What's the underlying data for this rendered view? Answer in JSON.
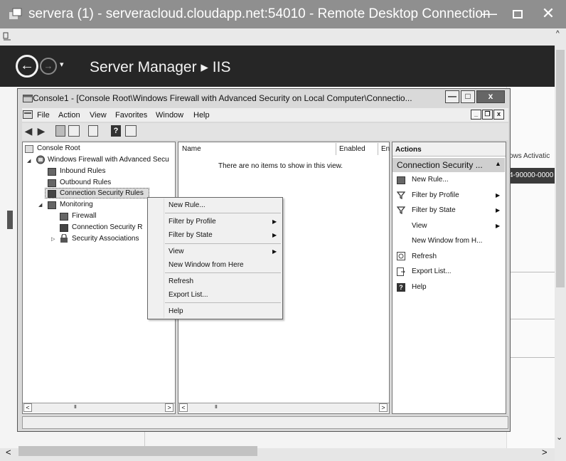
{
  "rdp": {
    "title": "servera (1) - serveracloud.cloudapp.net:54010 - Remote Desktop Connection",
    "minimize_glyph": "—",
    "close_glyph": "✕"
  },
  "server_manager": {
    "breadcrumb": "Server Manager ▸ IIS",
    "back_glyph": "←",
    "forward_glyph": "→",
    "dropdown_glyph": "▾"
  },
  "background": {
    "text_partial": "ows Activatic",
    "highlight_partial": "4-90000-0000"
  },
  "console": {
    "title": "Console1 - [Console Root\\Windows Firewall with Advanced Security on Local Computer\\Connectio...",
    "min_glyph": "—",
    "max_glyph": "□",
    "close_glyph": "x",
    "menu": [
      "File",
      "Action",
      "View",
      "Favorites",
      "Window",
      "Help"
    ],
    "mdi": {
      "min": "_",
      "restore": "❐",
      "close": "x"
    }
  },
  "toolbar": {
    "back": "◀",
    "forward": "▶",
    "help": "?"
  },
  "tree": {
    "root": "Console Root",
    "firewall": "Windows Firewall with Advanced Secu",
    "inbound": "Inbound Rules",
    "outbound": "Outbound Rules",
    "connection_security": "Connection Security Rules",
    "monitoring": "Monitoring",
    "mon_firewall": "Firewall",
    "mon_connection_security": "Connection Security R",
    "security_associations": "Security Associations"
  },
  "list": {
    "columns": [
      "Name",
      "Enabled",
      "En"
    ],
    "empty_message": "There are no items to show in this view."
  },
  "scroll": {
    "left": "<",
    "right": ">",
    "grip": "III"
  },
  "actions": {
    "title": "Actions",
    "section": "Connection Security ...",
    "section_arrow": "▲",
    "items": [
      "New Rule...",
      "Filter by Profile",
      "Filter by State",
      "View",
      "New Window from H...",
      "Refresh",
      "Export List...",
      "Help"
    ]
  },
  "context_menu": {
    "items": [
      "New Rule...",
      "Filter by Profile",
      "Filter by State",
      "View",
      "New Window from Here",
      "Refresh",
      "Export List...",
      "Help"
    ],
    "submenu_arrow": "▶"
  },
  "outer_scroll": {
    "left": "<",
    "right": ">",
    "up": "^",
    "down": "⌄"
  }
}
